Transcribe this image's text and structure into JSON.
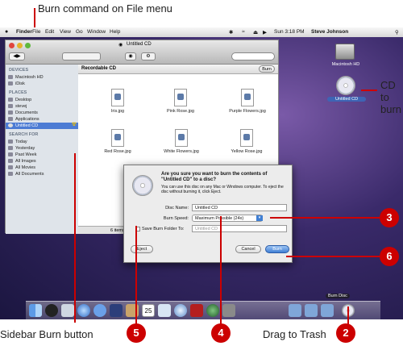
{
  "callouts": {
    "top": "Burn command on File menu",
    "cd": "CD\nto\nburn",
    "sidebar": "Sidebar Burn button",
    "trash": "Drag to Trash",
    "numbers": [
      "2",
      "3",
      "4",
      "5",
      "6"
    ]
  },
  "menubar": {
    "apple": "",
    "items": [
      "Finder",
      "File",
      "Edit",
      "View",
      "Go",
      "Window",
      "Help"
    ],
    "time": "Sun 3:18 PM",
    "user": "Steve Johnson"
  },
  "finder": {
    "title": "Untitled CD",
    "content_title": "Recordable CD",
    "burn_button": "Burn",
    "status": "6 items",
    "sidebar": {
      "devices_head": "DEVICES",
      "devices": [
        "Macintosh HD",
        "iDisk"
      ],
      "places_head": "PLACES",
      "places": [
        "Desktop",
        "stevej",
        "Documents",
        "Applications",
        "Untitled CD"
      ],
      "search_head": "SEARCH FOR",
      "search": [
        "Today",
        "Yesterday",
        "Past Week",
        "All Images",
        "All Movies",
        "All Documents"
      ]
    },
    "files": [
      "Iris.jpg",
      "Pink Rose.jpg",
      "Purple Flowers.jpg",
      "Red Rose.jpg",
      "White Flowers.jpg",
      "Yellow Rose.jpg"
    ],
    "file_badge": "JPEG"
  },
  "desktop": {
    "hd_label": "Macintosh HD",
    "cd_label": "Untitled CD"
  },
  "dialog": {
    "heading": "Are you sure you want to burn the contents of \"Untitled CD\" to a disc?",
    "body": "You can use this disc on any Mac or Windows computer. To eject the disc without burning it, click Eject.",
    "disc_name_label": "Disc Name:",
    "disc_name_value": "Untitled CD",
    "burn_speed_label": "Burn Speed:",
    "burn_speed_value": "Maximum Possible (24x)",
    "save_folder_label": "Save Burn Folder To:",
    "save_folder_value": "Untitled CD",
    "eject": "Eject",
    "cancel": "Cancel",
    "burn": "Burn"
  },
  "dock": {
    "burn_disc_label": "Burn Disc",
    "calendar_day": "25"
  }
}
